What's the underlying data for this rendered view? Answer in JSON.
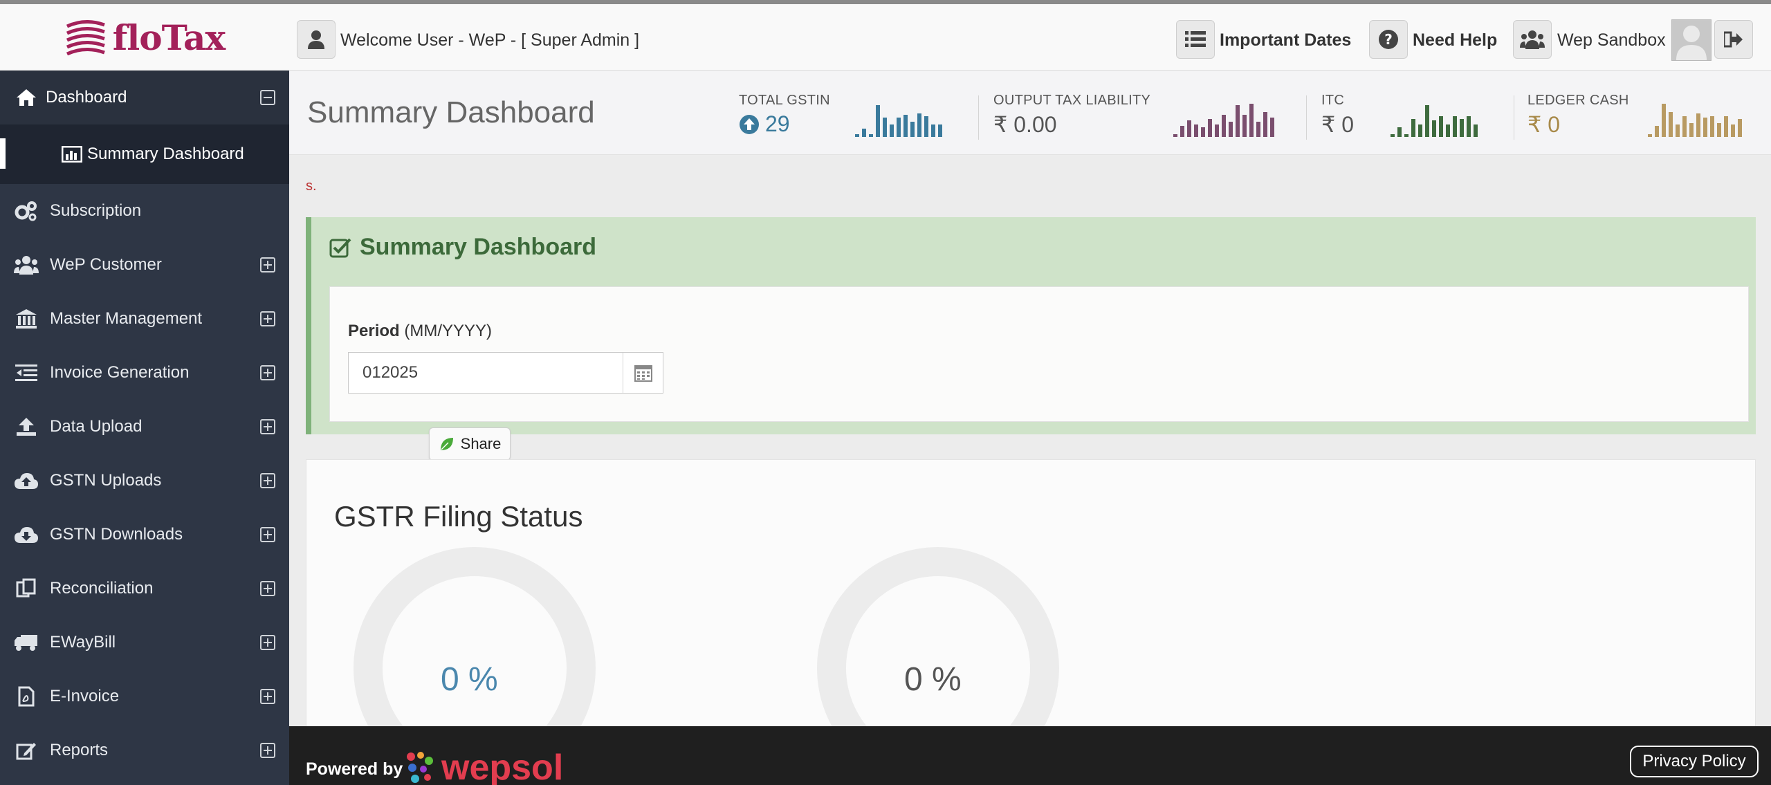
{
  "brand": {
    "name": "floTax",
    "color": "#a3215a"
  },
  "topbar": {
    "welcome": "Welcome User - WeP - [ Super Admin ]",
    "important_dates": "Important Dates",
    "need_help": "Need Help",
    "sandbox": "Wep Sandbox"
  },
  "sidebar": {
    "dashboard": "Dashboard",
    "summary_dashboard": "Summary Dashboard",
    "items": [
      {
        "label": "Subscription",
        "icon": "gears-icon",
        "expandable": false
      },
      {
        "label": "WeP Customer",
        "icon": "users-icon",
        "expandable": true
      },
      {
        "label": "Master Management",
        "icon": "bank-icon",
        "expandable": true
      },
      {
        "label": "Invoice Generation",
        "icon": "indent-icon",
        "expandable": true
      },
      {
        "label": "Data Upload",
        "icon": "upload-icon",
        "expandable": true
      },
      {
        "label": "GSTN Uploads",
        "icon": "cloud-upload-icon",
        "expandable": true
      },
      {
        "label": "GSTN Downloads",
        "icon": "cloud-download-icon",
        "expandable": true
      },
      {
        "label": "Reconciliation",
        "icon": "copy-icon",
        "expandable": true
      },
      {
        "label": "EWayBill",
        "icon": "truck-icon",
        "expandable": true
      },
      {
        "label": "E-Invoice",
        "icon": "pdf-file-icon",
        "expandable": true
      },
      {
        "label": "Reports",
        "icon": "edit-icon",
        "expandable": true
      }
    ]
  },
  "header": {
    "title": "Summary Dashboard",
    "stats": [
      {
        "label": "TOTAL GSTIN",
        "value": "29",
        "color": "#3a7a9c"
      },
      {
        "label": "OUTPUT TAX LIABILITY",
        "value": "₹ 0.00",
        "color": "#555555"
      },
      {
        "label": "ITC",
        "value": "₹ 0",
        "color": "#555555"
      },
      {
        "label": "LEDGER CASH",
        "value": "₹ 0",
        "color": "#a88a4a"
      }
    ]
  },
  "notice": "s.",
  "panel": {
    "title": "Summary Dashboard",
    "period_label_bold": "Period",
    "period_label_rest": " (MM/YYYY)",
    "period_value": "012025"
  },
  "share": {
    "label": "Share"
  },
  "gstr": {
    "title": "GSTR Filing Status",
    "donuts": [
      {
        "value": "0 %",
        "color": "#4a87ad"
      },
      {
        "value": "0 %",
        "color": "#555555"
      }
    ]
  },
  "footer": {
    "powered_by": "Powered by",
    "wepsol": "wepsol",
    "privacy": "Privacy Policy"
  }
}
